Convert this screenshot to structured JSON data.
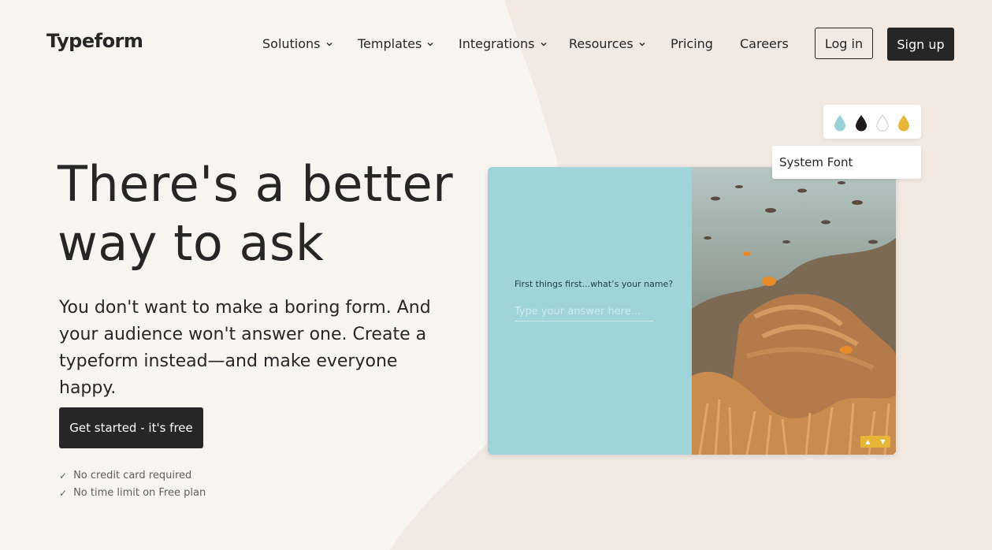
{
  "brand": {
    "name": "Typeform"
  },
  "nav": {
    "items": [
      {
        "label": "Solutions",
        "has_dropdown": true
      },
      {
        "label": "Templates",
        "has_dropdown": true
      },
      {
        "label": "Integrations",
        "has_dropdown": true
      },
      {
        "label": "Resources",
        "has_dropdown": true
      },
      {
        "label": "Pricing",
        "has_dropdown": false
      },
      {
        "label": "Careers",
        "has_dropdown": false
      }
    ],
    "login_label": "Log in",
    "signup_label": "Sign up"
  },
  "hero": {
    "title": "There's a better way to ask",
    "subtitle": "You don't want to make a boring form. And your audience won't answer one. Create a typeform instead—and make everyone happy.",
    "cta_label": "Get started - it's free",
    "perks": [
      "No credit card required",
      "No time limit on Free plan"
    ]
  },
  "preview": {
    "question": "First things first...what’s your name?",
    "answer_placeholder": "Type your answer here...",
    "theme_colors": [
      "#98d1d8",
      "#1f1a1b",
      "#ffffff",
      "#e8b637"
    ],
    "font_label": "System Font"
  },
  "colors": {
    "background": "#f8f5f1",
    "accent_shape": "#f0e6df",
    "dark": "#262627",
    "preview_panel": "#9fd4db"
  },
  "icons": {
    "dropdown": "chevron-down-icon",
    "check": "check-icon",
    "drop": "color-drop-icon"
  }
}
